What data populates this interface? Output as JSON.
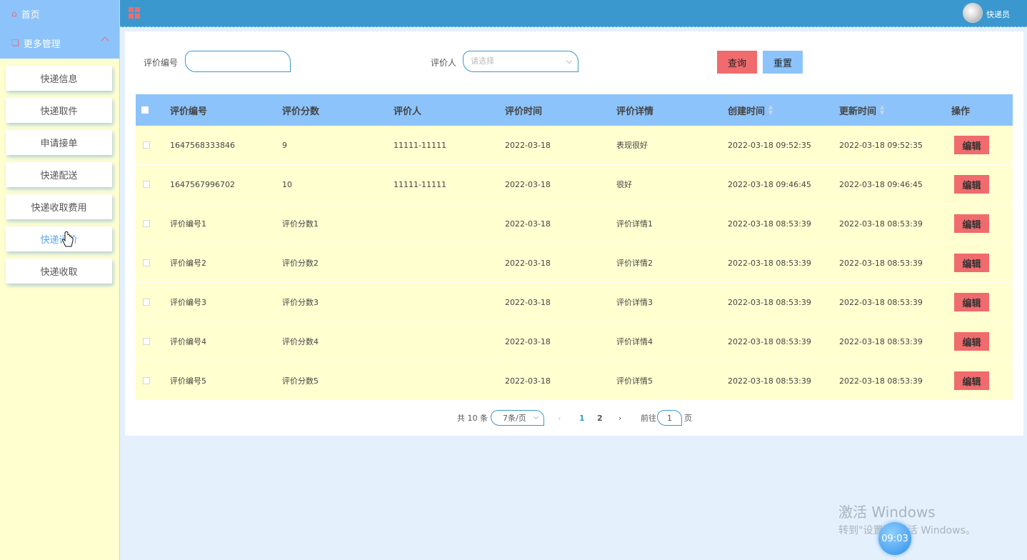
{
  "sidebar": {
    "home_label": "首页",
    "group_label": "更多管理",
    "items": [
      {
        "label": "快递信息"
      },
      {
        "label": "快递取件"
      },
      {
        "label": "申请接单"
      },
      {
        "label": "快递配送"
      },
      {
        "label": "快递收取费用"
      },
      {
        "label": "快递评价"
      },
      {
        "label": "快递收取"
      }
    ],
    "active_index": 5
  },
  "topbar": {
    "user_name": "快递员"
  },
  "filters": {
    "code_label": "评价编号",
    "code_value": "",
    "rater_label": "评价人",
    "rater_placeholder": "请选择",
    "query_label": "查询",
    "reset_label": "重置"
  },
  "table": {
    "headers": [
      "评价编号",
      "评价分数",
      "评价人",
      "评价时间",
      "评价详情",
      "创建时间",
      "更新时间",
      "操作"
    ],
    "rows": [
      {
        "code": "1647568333846",
        "score": "9",
        "rater": "11111-11111",
        "date": "2022-03-18",
        "detail": "表现很好",
        "created": "2022-03-18 09:52:35",
        "updated": "2022-03-18 09:52:35"
      },
      {
        "code": "1647567996702",
        "score": "10",
        "rater": "11111-11111",
        "date": "2022-03-18",
        "detail": "很好",
        "created": "2022-03-18 09:46:45",
        "updated": "2022-03-18 09:46:45"
      },
      {
        "code": "评价编号1",
        "score": "评价分数1",
        "rater": "",
        "date": "2022-03-18",
        "detail": "评价详情1",
        "created": "2022-03-18 08:53:39",
        "updated": "2022-03-18 08:53:39"
      },
      {
        "code": "评价编号2",
        "score": "评价分数2",
        "rater": "",
        "date": "2022-03-18",
        "detail": "评价详情2",
        "created": "2022-03-18 08:53:39",
        "updated": "2022-03-18 08:53:39"
      },
      {
        "code": "评价编号3",
        "score": "评价分数3",
        "rater": "",
        "date": "2022-03-18",
        "detail": "评价详情3",
        "created": "2022-03-18 08:53:39",
        "updated": "2022-03-18 08:53:39"
      },
      {
        "code": "评价编号4",
        "score": "评价分数4",
        "rater": "",
        "date": "2022-03-18",
        "detail": "评价详情4",
        "created": "2022-03-18 08:53:39",
        "updated": "2022-03-18 08:53:39"
      },
      {
        "code": "评价编号5",
        "score": "评价分数5",
        "rater": "",
        "date": "2022-03-18",
        "detail": "评价详情5",
        "created": "2022-03-18 08:53:39",
        "updated": "2022-03-18 08:53:39"
      }
    ],
    "edit_label": "编辑"
  },
  "pagination": {
    "total_text": "共 10 条",
    "page_size": "7条/页",
    "pages": [
      "1",
      "2"
    ],
    "current": "1",
    "goto_prefix": "前往",
    "goto_value": "1",
    "goto_suffix": "页"
  },
  "watermark": {
    "line1": "激活 Windows",
    "line2": "转到\"设置\"以激活 Windows。"
  },
  "clock": "09:03",
  "colors": {
    "sidebar_bg": "#ffffd0",
    "menu_blue": "#8cc3fa",
    "topbar": "#3a98cf",
    "danger": "#f06b6d",
    "row_bg": "#ffffd0"
  }
}
